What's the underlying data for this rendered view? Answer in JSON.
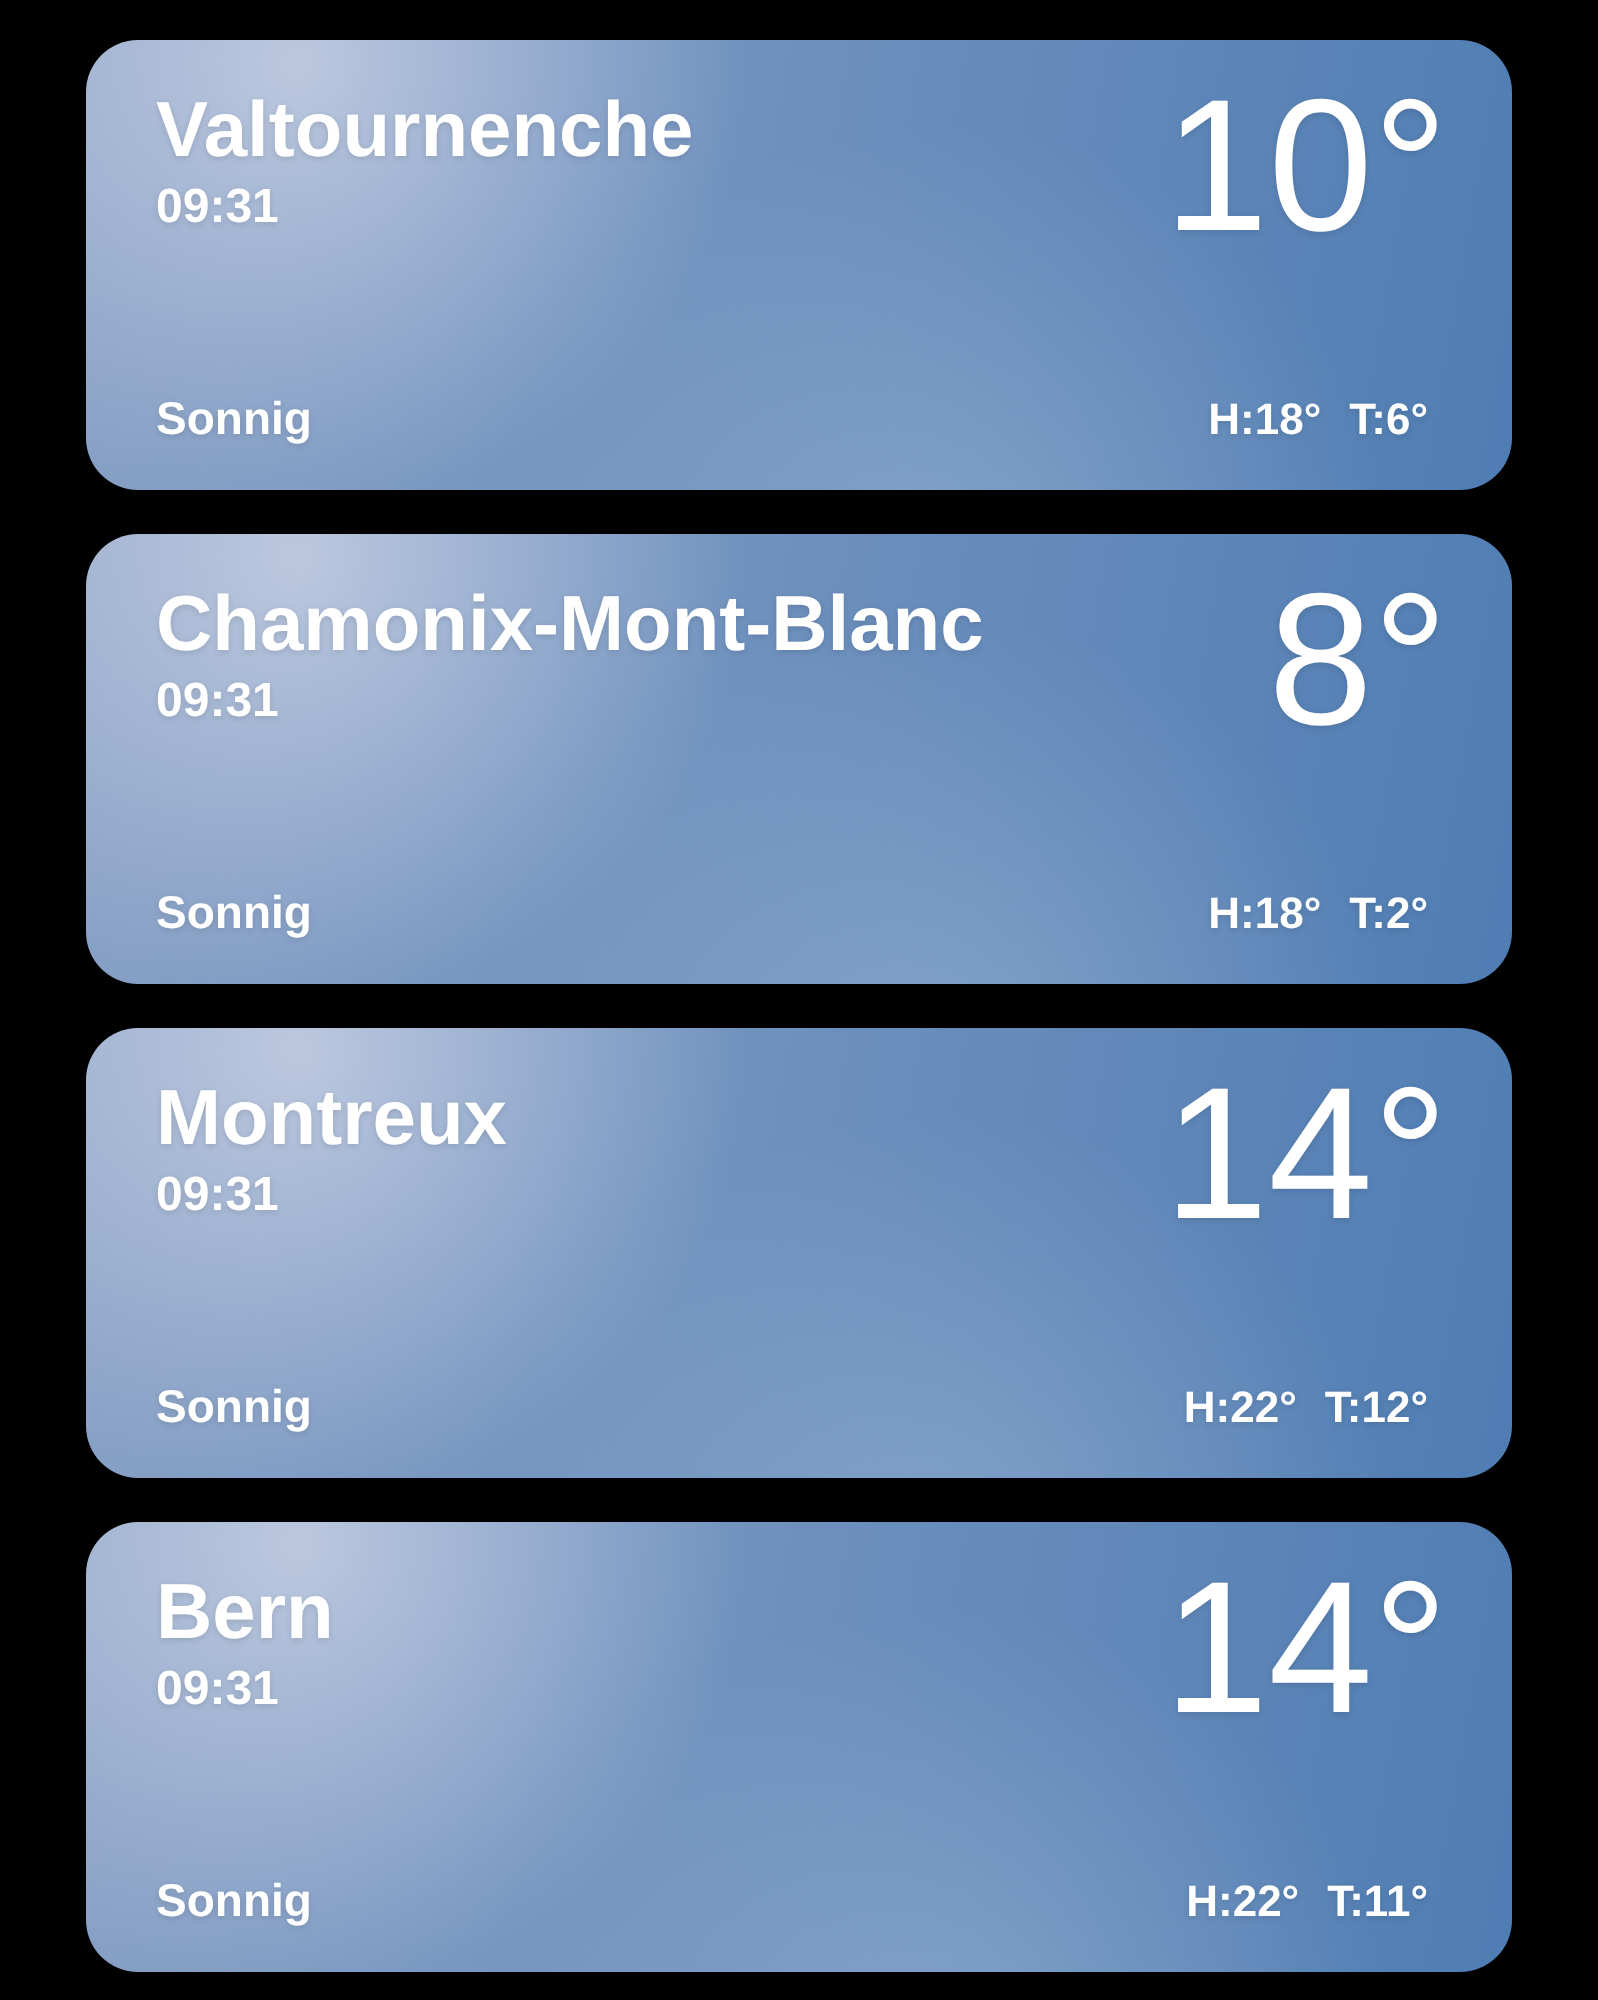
{
  "locations": [
    {
      "name": "Valtournenche",
      "time": "09:31",
      "temperature": "10°",
      "condition": "Sonnig",
      "high": "H:18°",
      "low": "T:6°"
    },
    {
      "name": "Chamonix-Mont-Blanc",
      "time": "09:31",
      "temperature": "8°",
      "condition": "Sonnig",
      "high": "H:18°",
      "low": "T:2°"
    },
    {
      "name": "Montreux",
      "time": "09:31",
      "temperature": "14°",
      "condition": "Sonnig",
      "high": "H:22°",
      "low": "T:12°"
    },
    {
      "name": "Bern",
      "time": "09:31",
      "temperature": "14°",
      "condition": "Sonnig",
      "high": "H:22°",
      "low": "T:11°"
    }
  ]
}
